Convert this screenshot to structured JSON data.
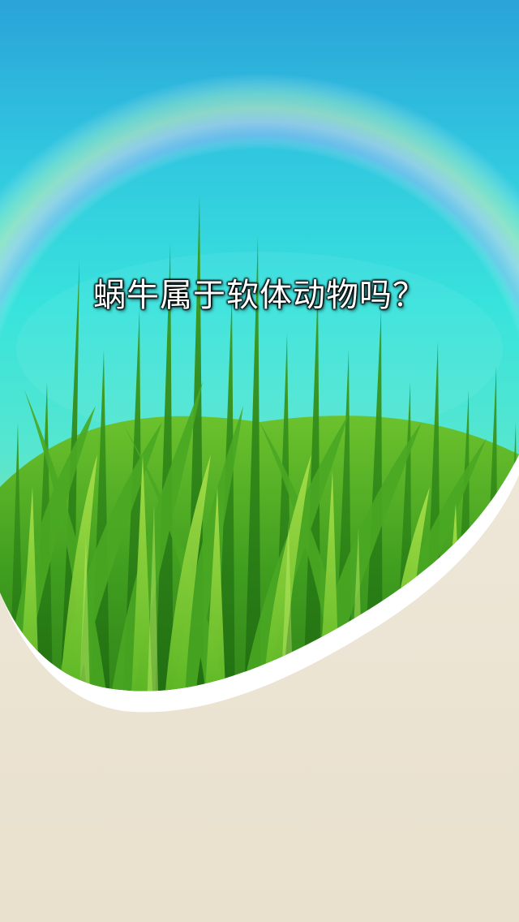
{
  "slide": {
    "question": "蜗牛属于软体动物吗？"
  },
  "scene": {
    "background": "sky-rainbow-grass-illustration",
    "colors": {
      "sky_top": "#2aa7d8",
      "sky_mid": "#35e2de",
      "grass_dark": "#2f8a1a",
      "grass_light": "#8fd437",
      "paper": "#ede5d4",
      "border": "#ffffff"
    }
  }
}
